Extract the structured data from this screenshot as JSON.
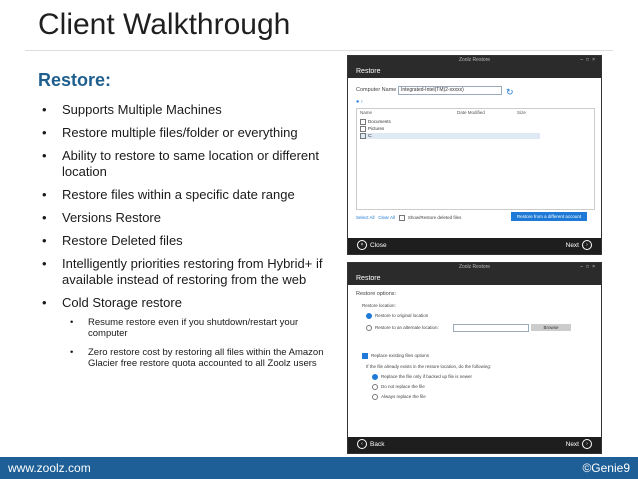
{
  "page": {
    "title": "Client Walkthrough",
    "subheading": "Restore:",
    "bullets": [
      "Supports Multiple Machines",
      "Restore multiple files/folder or everything",
      "Ability to restore to same location or different location",
      "Restore files within a specific date range",
      "Versions Restore",
      "Restore Deleted files",
      "Intelligently priorities restoring from Hybrid+ if available instead of restoring from the web",
      "Cold Storage restore"
    ],
    "sub_bullets": [
      "Resume restore even if you shutdown/restart your computer",
      "Zero restore cost by restoring all files within the Amazon Glacier free restore quota accounted to all Zoolz users"
    ]
  },
  "window1": {
    "app_title": "Zoolz Restore",
    "header": "Restore",
    "computer_label": "Computer Name",
    "computer_value": "Integrated-Intel(TM)2-xxxxx)",
    "columns": [
      "Name",
      "Date Modified",
      "Size"
    ],
    "tree_items": [
      "Documents",
      "Pictures",
      "C:"
    ],
    "link_select_all": "Select All",
    "link_clear_all": "Clear All",
    "show_deleted_label": "Show/Restore deleted files",
    "restore_button": "Restore from a different account",
    "footer_left": "Close",
    "footer_right": "Next"
  },
  "window2": {
    "app_title": "Zoolz Restore",
    "header": "Restore",
    "section": "Restore options:",
    "location_label": "Restore location:",
    "opt_original": "Restore to original location",
    "opt_alternate": "Restore to an alternate location:",
    "browse": "Browse",
    "replace_header": "Replace existing files options",
    "replace_desc": "If the file already exists in the restore location, do the following:",
    "replace_opt1": "Replace the file only if backed up file is newer",
    "replace_opt2": "Do not replace the file",
    "replace_opt3": "Always replace the file",
    "footer_left": "Back",
    "footer_right": "Next"
  },
  "footer": {
    "url": "www.zoolz.com",
    "copyright": "©Genie9"
  },
  "colors": {
    "accent": "#1d5f96",
    "subheading": "#1f5f8f",
    "window_header": "#2b2b2b",
    "button_blue": "#1e7ad6"
  }
}
